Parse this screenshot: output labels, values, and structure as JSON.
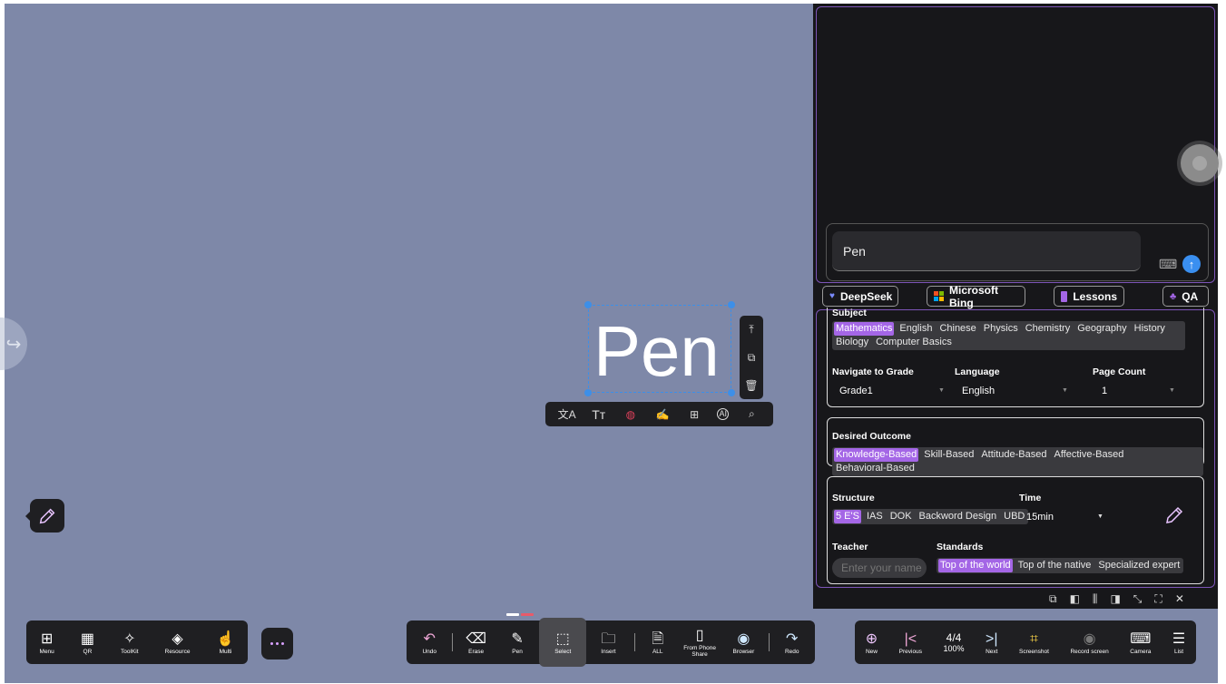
{
  "selection": {
    "text": "Pen"
  },
  "text_toolbar": {
    "icons": [
      "translate-icon",
      "font-size-icon",
      "color-palette-icon",
      "handwriting-icon",
      "table-icon",
      "ai-icon",
      "search-icon"
    ]
  },
  "panel": {
    "chat_input_value": "Pen",
    "tabs": {
      "deepseek": "DeepSeek",
      "bing": "Microsoft Bing",
      "lessons": "Lessons",
      "qa": "QA"
    },
    "subject": {
      "label": "Subject",
      "options": [
        "Mathematics",
        "English",
        "Chinese",
        "Physics",
        "Chemistry",
        "Geography",
        "History",
        "Biology",
        "Computer Basics"
      ],
      "selected": "Mathematics"
    },
    "grade": {
      "label": "Navigate to Grade",
      "value": "Grade1"
    },
    "language": {
      "label": "Language",
      "value": "English"
    },
    "page_count": {
      "label": "Page Count",
      "value": "1"
    },
    "outcome": {
      "label": "Desired Outcome",
      "options": [
        "Knowledge-Based",
        "Skill-Based",
        "Attitude-Based",
        "Affective-Based",
        "Behavioral-Based"
      ],
      "selected": "Knowledge-Based"
    },
    "structure": {
      "label": "Structure",
      "options": [
        "5 E'S",
        "IAS",
        "DOK",
        "Backword Design",
        "UBD"
      ],
      "selected": "5 E'S"
    },
    "time": {
      "label": "Time",
      "value": "15min"
    },
    "teacher": {
      "label": "Teacher",
      "placeholder": "Enter your name"
    },
    "standards": {
      "label": "Standards",
      "options": [
        "Top of the world",
        "Top of the native",
        "Specialized expert"
      ],
      "selected": "Top of the world"
    }
  },
  "left_bar": {
    "menu": "Menu",
    "qr": "QR",
    "toolkit": "ToolKit",
    "resource": "Resource",
    "multi": "Multi"
  },
  "center_bar": {
    "undo": "Undo",
    "erase": "Erase",
    "pen": "Pen",
    "select": "Select",
    "insert": "Insert",
    "all": "ALL",
    "phone_share": "From Phone Share",
    "browser": "Browser",
    "redo": "Redo"
  },
  "right_bar": {
    "new": "New",
    "previous": "Previous",
    "page": "4/4",
    "zoom": "100%",
    "next": "Next",
    "screenshot": "Screenshot",
    "record": "Record screen",
    "camera": "Camera",
    "list": "List"
  },
  "colors": {
    "accent": "#a466e6",
    "panel_border": "#7d55b8",
    "canvas": "#7e88a8",
    "send": "#3a8ff0"
  }
}
